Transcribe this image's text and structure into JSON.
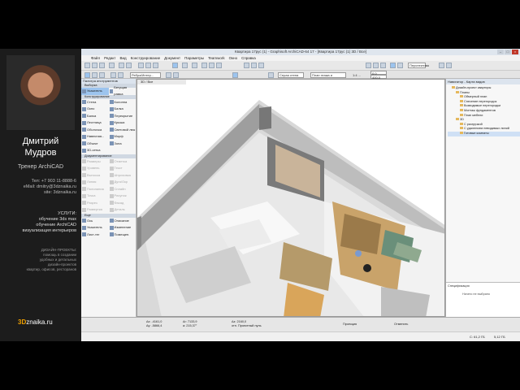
{
  "presenter": {
    "first_name": "Дмитрий",
    "last_name": "Мудров",
    "role": "Тренер ArchiCAD",
    "phone": "Тел: +7 903 11-8888-6",
    "email": "eMail: dmitry@3dznaika.ru",
    "site": "site: 3dznaika.ru",
    "services_title": "УСЛУГИ:",
    "services": [
      "обучение 3ds max",
      "обучение ArchiCAD",
      "визуализация интерьеров"
    ],
    "projects": [
      "ДИЗАЙН-ПРОЕКТЫ:",
      "помощь в создании",
      "удобных и детальных",
      "дизайн-проектов",
      "квартир, офисов, ресторанов"
    ],
    "logo_num": "3D",
    "logo_text": "znaika.ru"
  },
  "window": {
    "title": "Квартира 17рус (1) - Graphisoft ArchiCAD-64 17 - [Квартира 17рус (1) 3D / Все]",
    "controls": [
      "–",
      "□",
      "×"
    ]
  },
  "menu": [
    "Файл",
    "Редакт",
    "Вид",
    "Конструирование",
    "Документ",
    "Параметры",
    "Teamwork",
    "Окно",
    "Справка"
  ],
  "toolbar": {
    "view_select": "Ребра/Интер...",
    "floor_label": "Серая стена",
    "floor2_label": "План этажа и разрез...",
    "scale": "1:4 ...",
    "dim1": "0,0",
    "dim2": "400,0",
    "render": "Перспектива"
  },
  "toolbox": {
    "title": "Палитра инструментов",
    "select": "Выборка",
    "sections": {
      "construct": "Конструирование",
      "document": "Документирование",
      "more": "Еще"
    },
    "tools": [
      [
        "Указатель",
        "Бегущая рамка"
      ],
      [
        "Стена",
        "Колонна"
      ],
      [
        "Окно",
        "Балка"
      ],
      [
        "Балка",
        "Перекрытие"
      ],
      [
        "Лестница",
        "Крыша"
      ],
      [
        "Оболочка",
        "Световой люк"
      ],
      [
        "Навесная...",
        "Морф"
      ],
      [
        "Объект",
        "Зона"
      ],
      [
        "3D-сетка",
        ""
      ]
    ],
    "doc_tools": [
      [
        "Размеры",
        "Отметка"
      ],
      [
        "Уровень",
        "Текст"
      ],
      [
        "Выноска",
        "Штриховка"
      ],
      [
        "Линия",
        "Дуга/Окр"
      ],
      [
        "Полилиния",
        "Сплайн"
      ],
      [
        "Точка",
        "Рисунок"
      ],
      [
        "Разрез",
        "Фасад"
      ],
      [
        "Развертка",
        "Деталь"
      ]
    ],
    "more_tools": [
      [
        "Ось",
        "Описание"
      ],
      [
        "Указатель",
        "Изменение"
      ],
      [
        "Лист-тег",
        "Помещен."
      ]
    ]
  },
  "viewport": {
    "tab": "3D / Все"
  },
  "navigator": {
    "title": "Навигатор - Карта видов",
    "tree": [
      {
        "level": 1,
        "label": "Дизайн-проект квартиры"
      },
      {
        "level": 2,
        "label": "Планы"
      },
      {
        "level": 3,
        "label": "Обмерный план"
      },
      {
        "level": 3,
        "label": "Снесение перегородок"
      },
      {
        "level": 3,
        "label": "Возводимые перегородки"
      },
      {
        "level": 3,
        "label": "Монтаж фундаментов"
      },
      {
        "level": 3,
        "label": "План мебели"
      },
      {
        "level": 2,
        "label": "3D"
      },
      {
        "level": 3,
        "label": "С разгрузкой"
      },
      {
        "level": 3,
        "label": "С удалением невидимых линий"
      },
      {
        "level": 3,
        "label": "Готовые комнаты"
      }
    ],
    "spec_label": "Спецификация",
    "spec_value": "Ничего не выбрано"
  },
  "status": {
    "coords": [
      [
        "Δx: -4161,0",
        "Δy: -5866,4"
      ],
      [
        "Δr: 7133,9",
        "a: 215,37°"
      ],
      [
        "Δz: 2160,0",
        "отн. Проектный нуль"
      ]
    ],
    "label_a": "Проекция",
    "label_b": "Отменить",
    "disk_c": "C: 61,2 ГБ",
    "disk_d": "5,12 ГБ"
  }
}
